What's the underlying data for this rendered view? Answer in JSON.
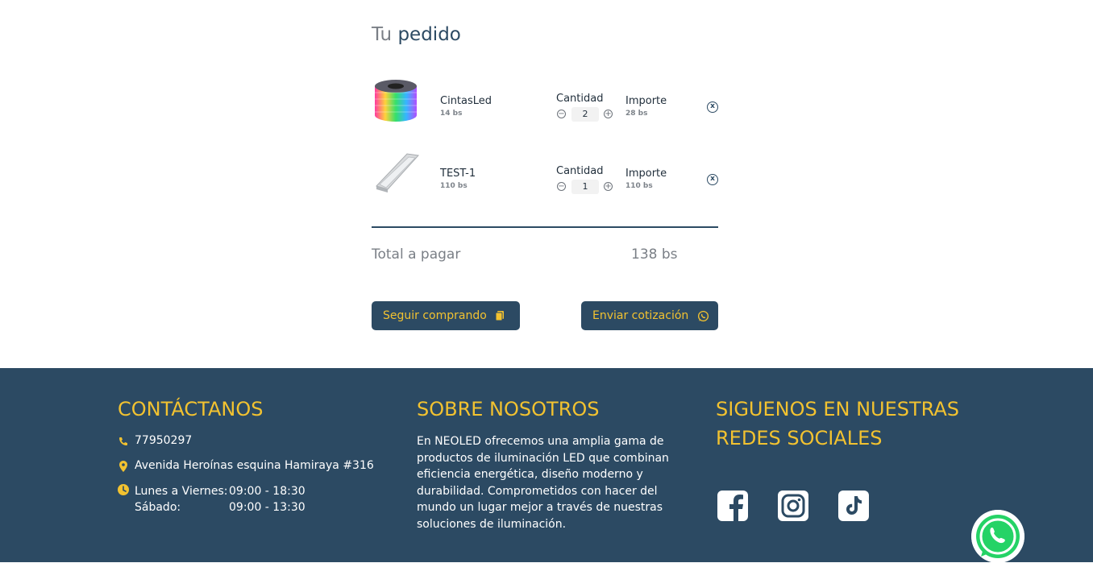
{
  "order": {
    "title_light": "Tu",
    "title_strong": "pedido",
    "items": [
      {
        "name": "CintasLed",
        "price": "14 bs",
        "qty_label": "Cantidad",
        "qty": "2",
        "importe_label": "Importe",
        "importe": "28 bs",
        "minus": "−",
        "plus": "+",
        "remove": "x"
      },
      {
        "name": "TEST-1",
        "price": "110 bs",
        "qty_label": "Cantidad",
        "qty": "1",
        "importe_label": "Importe",
        "importe": "110 bs",
        "minus": "−",
        "plus": "+",
        "remove": "x"
      }
    ],
    "total_label": "Total a pagar",
    "total_value": "138 bs",
    "continue_label": "Seguir comprando",
    "quote_label": "Enviar cotización"
  },
  "footer": {
    "contact": {
      "heading": "CONTÁCTANOS",
      "phone": "77950297",
      "address": "Avenida Heroínas esquina Hamiraya #316",
      "weekday_label": "Lunes a Viernes:",
      "weekday_hours": "09:00 - 18:30",
      "saturday_label": "Sábado:",
      "saturday_hours": "09:00 - 13:30"
    },
    "about": {
      "heading": "SOBRE NOSOTROS",
      "text": "En NEOLED ofrecemos una amplia gama de productos de iluminación LED que combinan eficiencia energética, diseño moderno y durabilidad. Comprometidos con hacer del mundo un lugar mejor a través de nuestras soluciones de iluminación."
    },
    "social": {
      "heading_line1": "SIGUENOS EN NUESTRAS",
      "heading_line2": "REDES SOCIALES",
      "icons": [
        "facebook-icon",
        "instagram-icon",
        "tiktok-icon"
      ]
    }
  },
  "colors": {
    "primary": "#2c4a63",
    "accent": "#f2c230"
  }
}
